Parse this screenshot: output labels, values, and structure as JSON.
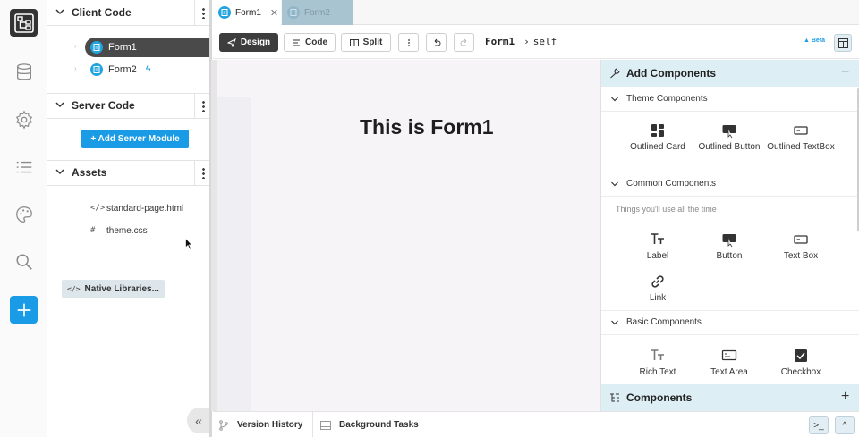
{
  "client_code": {
    "title": "Client Code",
    "forms": [
      {
        "label": "Form1",
        "selected": true
      },
      {
        "label": "Form2",
        "selected": false,
        "badge_icon": "bolt-icon"
      }
    ]
  },
  "server_code": {
    "title": "Server Code",
    "add_button": "+ Add Server Module"
  },
  "assets": {
    "title": "Assets",
    "files": [
      {
        "icon": "</>",
        "label": "standard-page.html"
      },
      {
        "icon": "#",
        "label": "theme.css"
      }
    ]
  },
  "native_libraries": {
    "icon": "</>",
    "label": "Native Libraries..."
  },
  "tabs": [
    {
      "label": "Form1",
      "active": true,
      "close": "✕"
    },
    {
      "label": "Form2",
      "active": false
    }
  ],
  "toolbar": {
    "design": "Design",
    "code": "Code",
    "split": "Split",
    "breadcrumb_form": "Form1",
    "breadcrumb_sep": "›",
    "breadcrumb_self": "self",
    "beta": "Beta"
  },
  "canvas": {
    "heading": "This is Form1"
  },
  "add_components": {
    "title": "Add Components",
    "collapse_symbol": "−",
    "categories": [
      {
        "title": "Theme Components",
        "description": "",
        "items": [
          "Outlined Card",
          "Outlined Button",
          "Outlined TextBox"
        ]
      },
      {
        "title": "Common Components",
        "description": "Things you'll use all the time",
        "items": [
          "Label",
          "Button",
          "Text Box",
          "Link"
        ]
      },
      {
        "title": "Basic Components",
        "description": "",
        "items": [
          "Rich Text",
          "Text Area",
          "Checkbox"
        ]
      }
    ]
  },
  "components_panel": {
    "title": "Components",
    "expand_symbol": "+"
  },
  "bottom": {
    "version_history": "Version History",
    "background_tasks": "Background Tasks",
    "collapse_symbol": "«",
    "terminal_symbol": ">_",
    "expand_symbol": "^"
  },
  "colors": {
    "accent": "#1a9be6",
    "selected_row": "#4a4a4a",
    "panel_header": "#ddeef4",
    "inactive_tab": "#a9c4d1"
  }
}
